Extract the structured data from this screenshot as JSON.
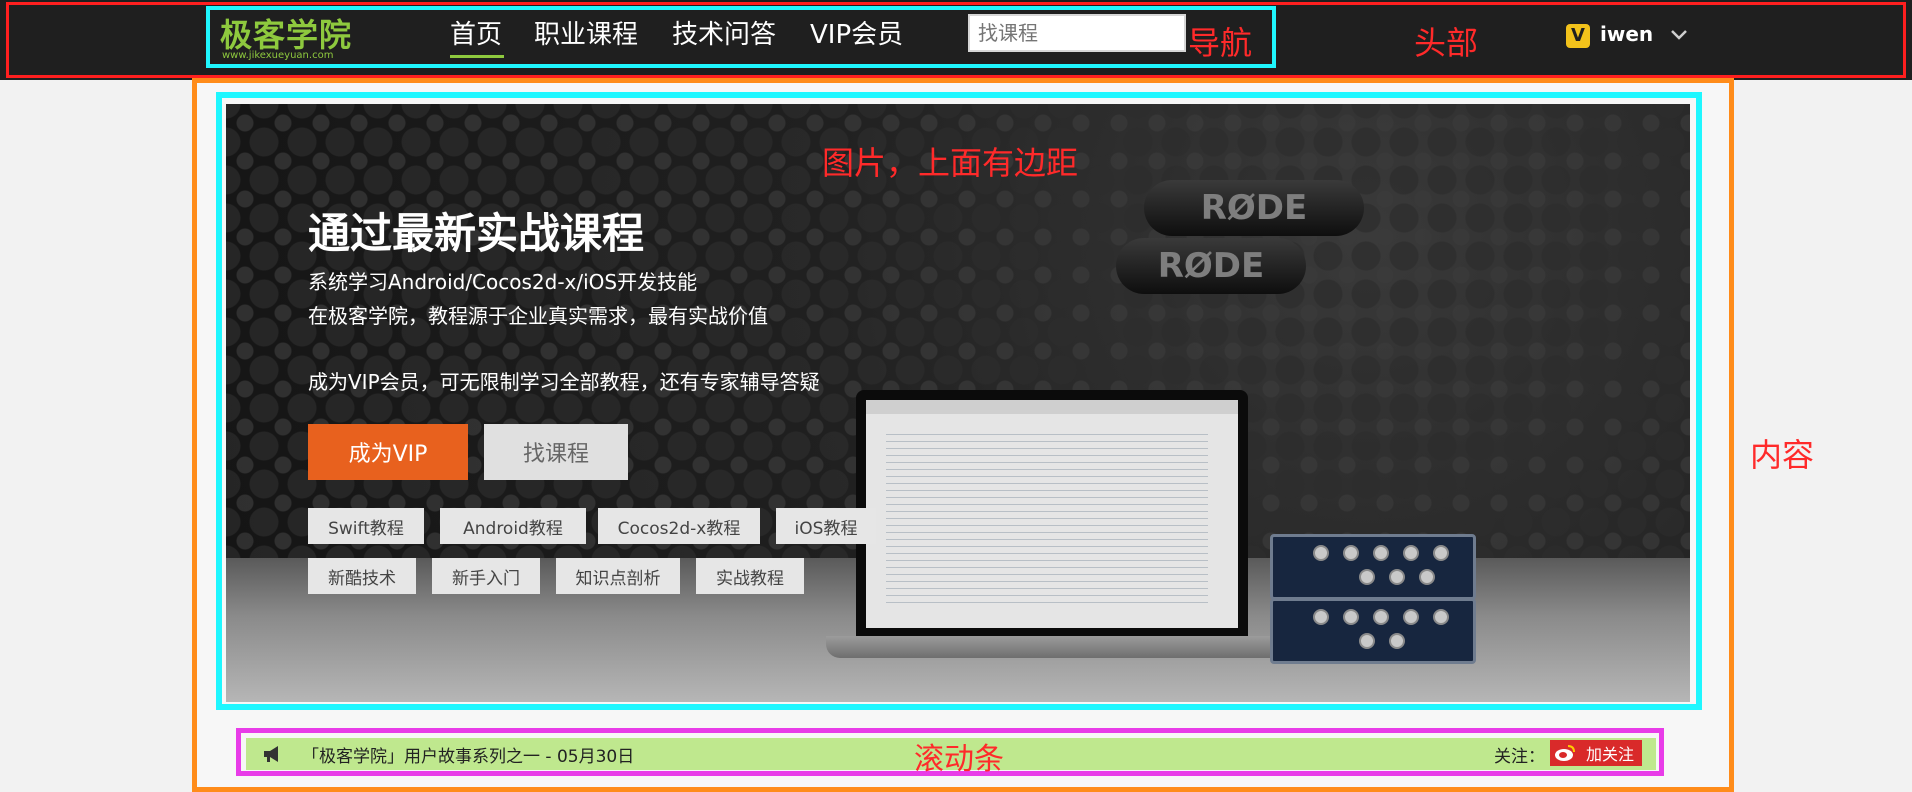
{
  "header": {
    "logo_cn": "极客学院",
    "logo_en": "www.jikexueyuan.com",
    "nav": [
      {
        "label": "首页"
      },
      {
        "label": "职业课程"
      },
      {
        "label": "技术问答"
      },
      {
        "label": "VIP会员"
      }
    ],
    "search_placeholder": "找课程",
    "vip_badge": "V",
    "username": "iwen"
  },
  "annotations": {
    "nav": "导航",
    "header": "头部",
    "image": "图片，上面有边距",
    "content": "内容",
    "ticker": "滚动条"
  },
  "hero": {
    "title": "通过最新实战课程",
    "line1": "系统学习Android/Cocos2d-x/iOS开发技能",
    "line2": "在极客学院，教程源于企业真实需求，最有实战价值",
    "line3": "成为VIP会员，可无限制学习全部教程，还有专家辅导答疑",
    "btn_vip": "成为VIP",
    "btn_course": "找课程",
    "mic_text": "RØDE",
    "tags_row1": [
      "Swift教程",
      "Android教程",
      "Cocos2d-x教程",
      "iOS教程"
    ],
    "tags_row2": [
      "新酷技术",
      "新手入门",
      "知识点剖析",
      "实战教程"
    ]
  },
  "ticker": {
    "text": "「极客学院」用户故事系列之一 - 05月30日",
    "follow_label": "关注：",
    "follow_button": "加关注"
  },
  "colors": {
    "header_bg": "#1f1f1f",
    "brand_green": "#8ec93e",
    "vip_orange": "#e8611e",
    "annotation_red": "#ff2a2a",
    "outline_cyan": "#1ff7ff",
    "outline_orange": "#ff8c1a",
    "outline_magenta": "#e83ce8",
    "ticker_bg": "#bfe88e"
  }
}
